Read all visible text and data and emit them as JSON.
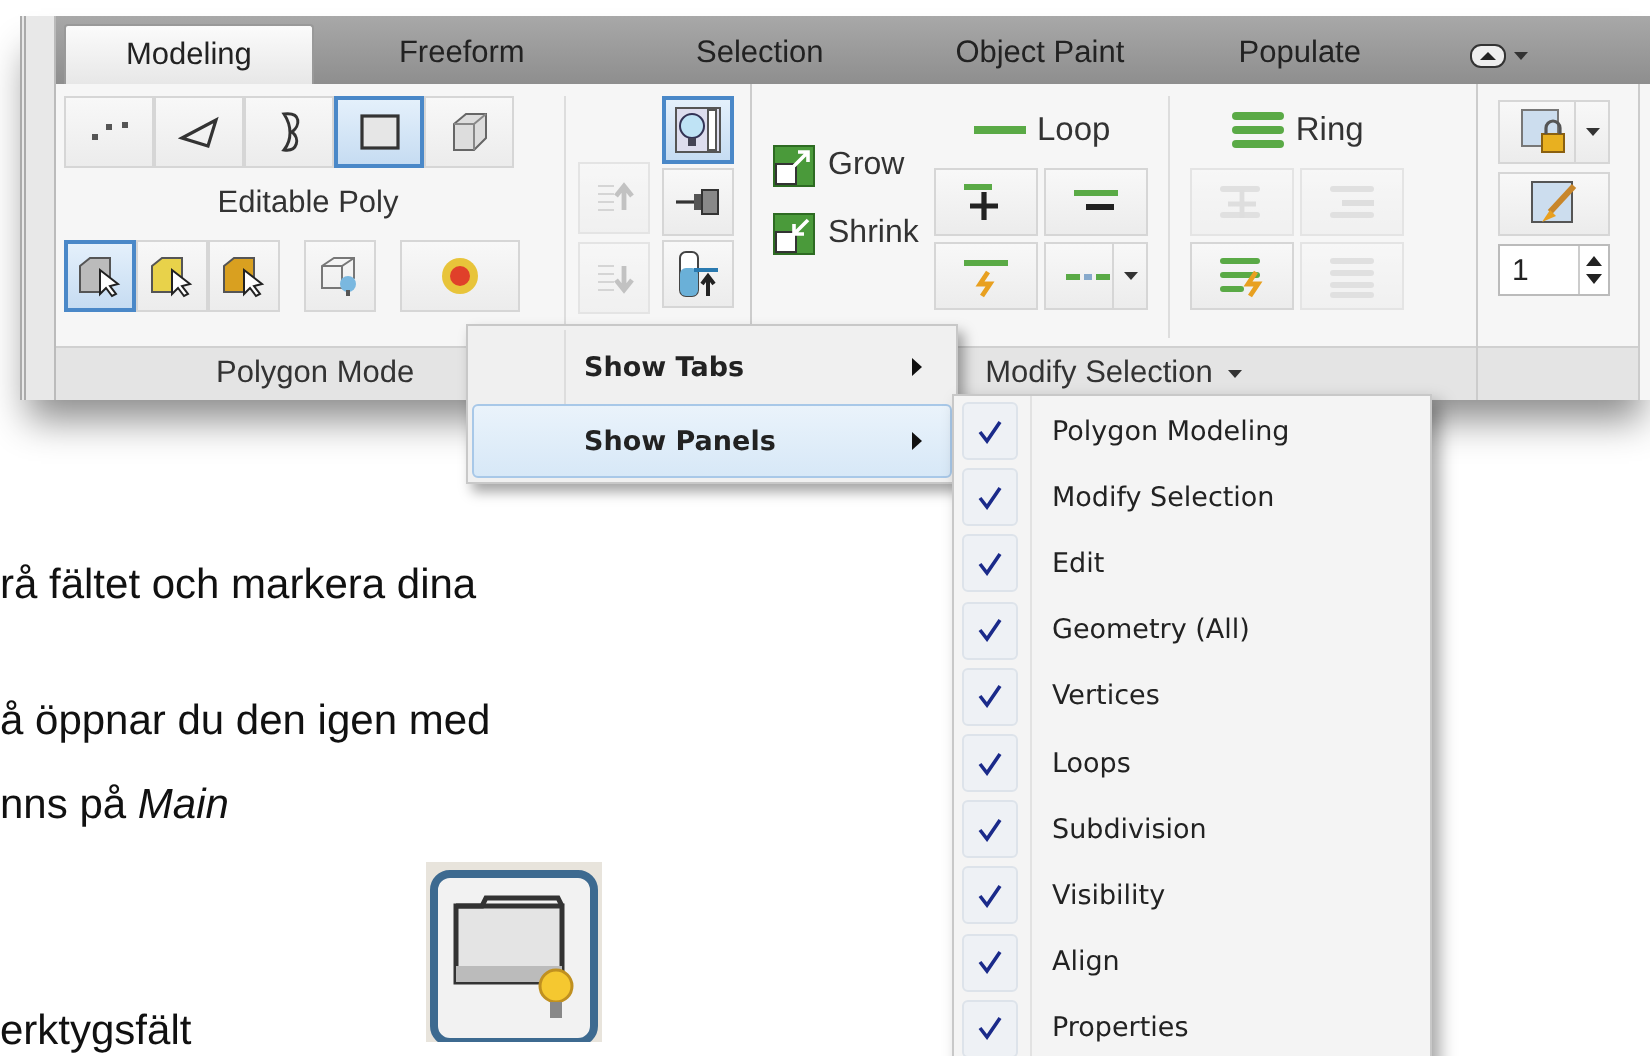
{
  "ribbon": {
    "tabs": [
      {
        "label": "Modeling",
        "selected": true
      },
      {
        "label": "Freeform",
        "selected": false
      },
      {
        "label": "Selection",
        "selected": false
      },
      {
        "label": "Object Paint",
        "selected": false
      },
      {
        "label": "Populate",
        "selected": false
      }
    ],
    "polygon_panel": {
      "label": "Polygon Mode",
      "object_type": "Editable Poly",
      "sub_objects": [
        {
          "selected": false
        },
        {
          "selected": false
        },
        {
          "selected": false
        },
        {
          "selected": true
        },
        {
          "selected": false
        }
      ],
      "selection_modes": [
        {
          "selected": true
        },
        {
          "selected": false
        },
        {
          "selected": false
        },
        {
          "selected": false
        },
        {
          "selected": false
        }
      ],
      "stack_buttons": [
        {
          "disabled": true
        },
        {
          "disabled": true
        }
      ],
      "toggles": [
        {
          "selected": true
        },
        {
          "selected": false
        },
        {
          "selected": false
        }
      ]
    },
    "modify_panel": {
      "label": "Modify Selection",
      "grow": "Grow",
      "shrink": "Shrink",
      "loop": {
        "label": "Loop",
        "buttons": [
          {
            "disabled": false
          },
          {
            "disabled": false
          },
          {
            "disabled": false
          },
          {
            "disabled": false
          }
        ]
      },
      "ring": {
        "label": "Ring",
        "buttons": [
          {
            "disabled": true
          },
          {
            "disabled": true
          },
          {
            "disabled": false
          },
          {
            "disabled": true
          }
        ]
      }
    },
    "extra_panel": {
      "spinner_value": "1"
    }
  },
  "context_menu": {
    "items": [
      {
        "label": "Show Tabs",
        "selected": false
      },
      {
        "label": "Show Panels",
        "selected": true
      }
    ]
  },
  "submenu": {
    "items": [
      {
        "label": "Polygon Modeling",
        "checked": true
      },
      {
        "label": "Modify Selection",
        "checked": true
      },
      {
        "label": "Edit",
        "checked": true
      },
      {
        "label": "Geometry (All)",
        "checked": true
      },
      {
        "label": "Vertices",
        "checked": true
      },
      {
        "label": "Loops",
        "checked": true
      },
      {
        "label": "Subdivision",
        "checked": true
      },
      {
        "label": "Visibility",
        "checked": true
      },
      {
        "label": "Align",
        "checked": true
      },
      {
        "label": "Properties",
        "checked": true
      }
    ]
  },
  "document": {
    "lines": [
      "rå fältet och markera dina",
      "å öppnar du den igen med",
      "nns på *Main*",
      "erktygsfält"
    ]
  }
}
